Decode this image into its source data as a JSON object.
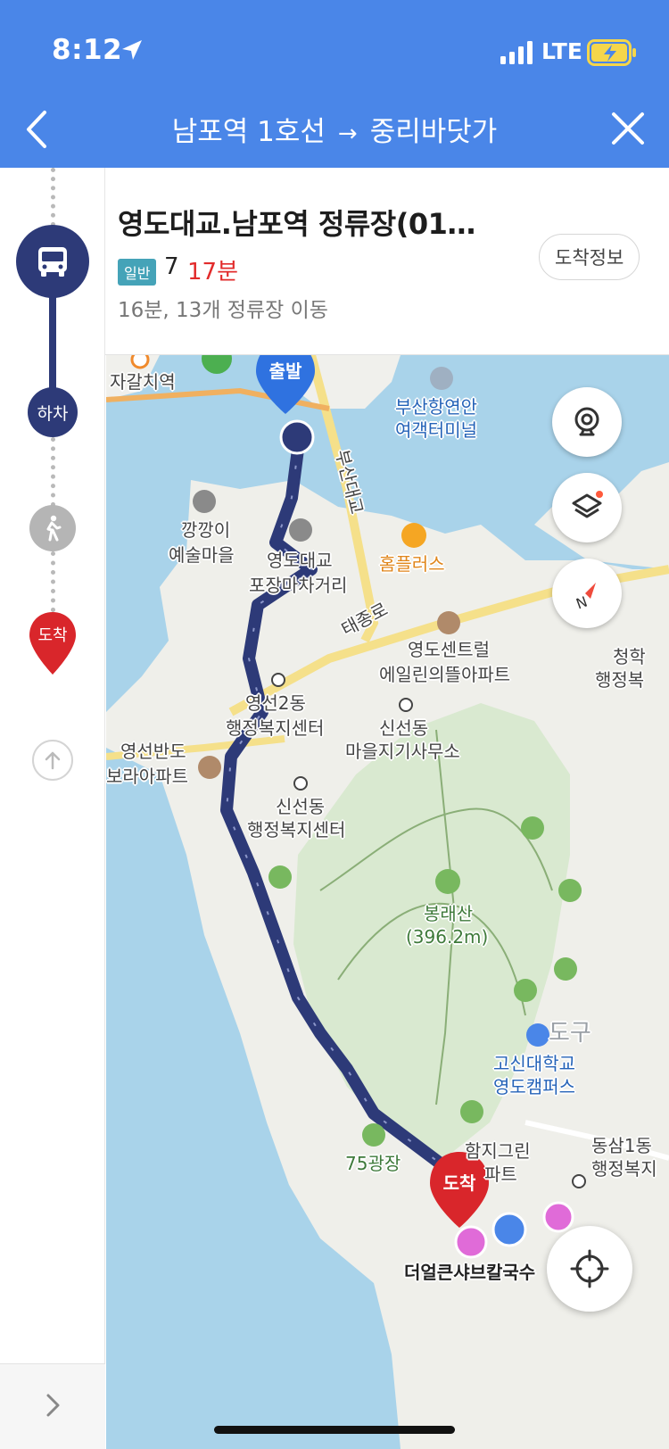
{
  "status_bar": {
    "time": "8:12",
    "network": "LTE"
  },
  "header": {
    "origin": "남포역 1호선",
    "arrow": "→",
    "destination": "중리바닷가"
  },
  "timeline": {
    "alight_label": "하차",
    "arrive_label": "도착"
  },
  "card": {
    "stop_name": "영도대교.남포역 정류장(01…",
    "bus_type": "일반",
    "bus_number": "7",
    "arrival_time": "17분",
    "route_meta": "16분, 13개 정류장 이동",
    "arrival_info_button": "도착정보"
  },
  "map": {
    "departure_pin": "출발",
    "arrival_pin": "도착",
    "labels": {
      "jagalchi": "자갈치역",
      "terminal_1": "부산항연안",
      "terminal_2": "여객터미널",
      "kkangkkang_1": "깡깡이",
      "kkangkkang_2": "예술마을",
      "pocha_1": "영도대교",
      "pocha_2": "포장마차거리",
      "homeplus": "홈플러스",
      "busan_bridge": "부산대교",
      "taejong_ro": "태종로",
      "central_1": "영도센트럴",
      "central_2": "에일린의뜰아파트",
      "cheonghak_1": "청학",
      "cheonghak_2": "행정복",
      "yeongseon_1": "영선2동",
      "yeongseon_2": "행정복지센터",
      "sinseon_village_1": "신선동",
      "sinseon_village_2": "마을지기사무소",
      "bora_1": "영선반도",
      "bora_2": "보라아파트",
      "sinseon_admin_1": "신선동",
      "sinseon_admin_2": "행정복지센터",
      "bongrae_1": "봉래산",
      "bongrae_2": "(396.2m)",
      "district": "도구",
      "kosin_1": "고신대학교",
      "kosin_2": "영도캠퍼스",
      "dongsam_1": "동삼1동",
      "dongsam_2": "행정복지",
      "park75": "75광장",
      "hamji_1": "함지그린",
      "hamji_2": "파트",
      "restaurant": "더얼큰샤브칼국수"
    }
  },
  "colors": {
    "header": "#4a86e8",
    "route": "#2d3a78",
    "arrival_red": "#e22b2b",
    "bus_type_badge": "#45a3b8"
  }
}
